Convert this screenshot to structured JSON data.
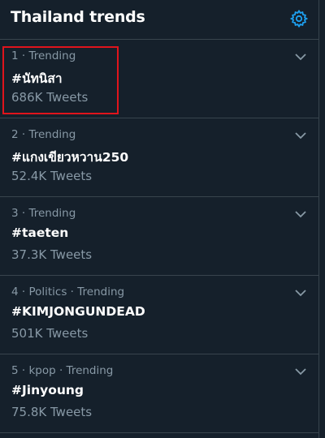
{
  "header": {
    "title": "Thailand trends",
    "settings_icon": "gear-icon",
    "accent_color": "#1da1f2"
  },
  "trends": [
    {
      "meta": "1 · Trending",
      "name": "#นัทนิสา",
      "count": "686K Tweets"
    },
    {
      "meta": "2 · Trending",
      "name": "#แกงเขียวหวาน250",
      "count": "52.4K Tweets"
    },
    {
      "meta": "3 · Trending",
      "name": "#taeten",
      "count": "37.3K Tweets"
    },
    {
      "meta": "4 · Politics · Trending",
      "name": "#KIMJONGUNDEAD",
      "count": "501K Tweets"
    },
    {
      "meta": "5 · kpop · Trending",
      "name": "#Jinyoung",
      "count": "75.8K Tweets"
    }
  ],
  "highlight_color": "#e0141c"
}
